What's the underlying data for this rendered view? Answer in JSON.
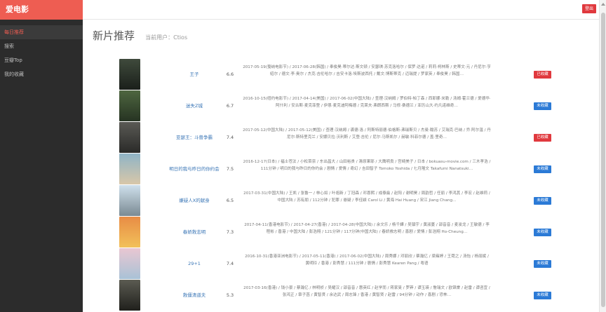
{
  "app": {
    "brand": "爱电影"
  },
  "sidebar": {
    "items": [
      {
        "label": "每日推荐",
        "active": true
      },
      {
        "label": "搜索",
        "active": false
      },
      {
        "label": "豆瓣Top",
        "active": false
      },
      {
        "label": "我的收藏",
        "active": false
      }
    ]
  },
  "topbar": {
    "logout_label": "登出"
  },
  "header": {
    "title": "新片推荐",
    "user_prefix": "当前用户：",
    "user_name": "Ctios"
  },
  "movies": [
    {
      "title": "王子",
      "rating": "6.6",
      "meta": "2017-05-19(戛纳电影节) / 2017-06-28(韩国) / 奉俊昊·蒂尔达·斯文顿 / 安瑟琪·苏克洛哈尔 / 保罗·达诺 / 莉莉·柯林斯 / 史蒂文·元 / 丹尼尔·亨绍尔 / 德文·李·奥尔 / 杰克·吉伦哈尔 / 吉安卡洛·埃斯波西托 / 戴文·博斯蒂克 / 迈瑞提 / 罗家英 / 奉俊昊 / 韩国…",
      "fav": "已收藏",
      "saved": true,
      "poster": [
        "#3f4a3c",
        "#1a1f1a"
      ]
    },
    {
      "title": "迷失Z城",
      "rating": "6.7",
      "meta": "2016-10-15(纽约电影节) / 2017-04-14(美国) / 2017-06-02(中国大陆) / 查理·汉纳姆 / 罗伯特·帕丁森 / 西耶娜·米勒 / 汤姆·霍兰德 / 爱德华·阿什利 / 安古斯·麦克菲登 / 伊恩·麦克迪阿梅德 / 克莱夫·弗朗西斯 / 马修·桑德兰 / 亚历山大·约凡诺维奇…",
      "fav": "未收藏",
      "saved": false,
      "poster": [
        "#4e6640",
        "#263322"
      ]
    },
    {
      "title": "亚瑟王：斗兽争霸",
      "rating": "7.4",
      "meta": "2017-05-12(中国大陆) / 2017-05-12(美国) / 查理·汉纳姆 / 裘德·洛 / 阿斯特丽德·伯格斯-弗瑞斯贝 / 杰曼·翰苏 / 艾瑞克·巴纳 / 乔·阿尔温 / 丹尼尔·斯特里克兰 / 安娜贝拉·沃利斯 / 艾登·吉伦 / 尼尔·马斯凯尔 / 赫敏·科菲尔德 / 盖·里奇…",
      "fav": "已收藏",
      "saved": true,
      "poster": [
        "#5a5a55",
        "#2a2a28"
      ]
    },
    {
      "title": "明日的我与昨日的你约会",
      "rating": "7.5",
      "meta": "2016-12-17(日本) / 福士苍汰 / 小松菜奈 / 东出昌大 / 山田裕贵 / 清原果耶 / 大鹰明良 / 宫崎美子 / 日本 / bokuasu-movie.com / 三木孝浩 / 111分钟 / 明日的我与昨日的你约会 / 剧情 / 爱情 / 奇幻 / 吉田智子 Tomoko Yoshida / 七月隆文 Takafumi Nanatsuki…",
      "fav": "未收藏",
      "saved": false,
      "poster": [
        "#8fb4c6",
        "#d8c7a9"
      ]
    },
    {
      "title": "嫌疑人X的献身",
      "rating": "6.5",
      "meta": "2017-03-31(中国大陆) / 王凯 / 张鲁一 / 林心如 / 叶祖新 / 丁冠森 / 邓恩熙 / 成泰燊 / 赵阳 / 谢明昊 / 周韵哲 / 任丽 / 李鸿其 / 李宏 / 赵维莉 / 中国大陆 / 苏有朋 / 112分钟 / 犯罪 / 悬疑 / 李佳颖 Carol Li / 黄海 Hai Huang / 宋江 Jiang Chang…",
      "fav": "未收藏",
      "saved": false,
      "poster": [
        "#cfe0ec",
        "#7a8a93"
      ]
    },
    {
      "title": "春娇救志明",
      "rating": "7.3",
      "meta": "2017-04-11(香港电影节) / 2017-04-27(香港) / 2017-04-28(中国大陆) / 余文乐 / 杨千嬅 / 吴镇宇 / 黄淑蔓 / 邵音音 / 麦浚龙 / 王敏德 / 李程彬 / 香港 / 中国大陆 / 彭浩翔 / 121分钟 / 117分钟(中国大陆) / 春娇救志明 / 喜剧 / 爱情 / 彭浩翔 Ho-Cheung…",
      "fav": "未收藏",
      "saved": false,
      "poster": [
        "#e88c45",
        "#f2c15a"
      ]
    },
    {
      "title": "29+1",
      "rating": "7.4",
      "meta": "2016-10-31(香港亚洲电影节) / 2017-05-11(香港) / 2017-06-02(中国大陆) / 周秀娜 / 邓丽欣 / 蔡瀚亿 / 梁雍婷 / 王菀之 / 汤怡 / 杨丽斌 / 黄明玲 / 香港 / 彭秀慧 / 111分钟 / 剧情 / 彭秀慧 Kearen Pang / 粤语",
      "fav": "未收藏",
      "saved": false,
      "poster": [
        "#e9c7d2",
        "#a9c2d6"
      ]
    },
    {
      "title": "救僵清道夫",
      "rating": "5.3",
      "meta": "2017-03-16(香港) / 钱小豪 / 蔡瀚亿 / 林明祯 / 吴耀汉 / 邵音音 / 惠英红 / 赵学而 / 蒋家旻 / 罗莽 / 谭玉瑛 / 詹瑞文 / 欧锦棠 / 赵雷 / 谭咨宜 / 张鸿正 / 章子菡 / 黄智贤 / 余达武 / 周志锋 / 香港 / 黄智贤 / 赵雷 / 94分钟 / 动作 / 喜剧 / 恐怖…",
      "fav": "未收藏",
      "saved": false,
      "poster": [
        "#5b5b52",
        "#20201c"
      ]
    }
  ]
}
